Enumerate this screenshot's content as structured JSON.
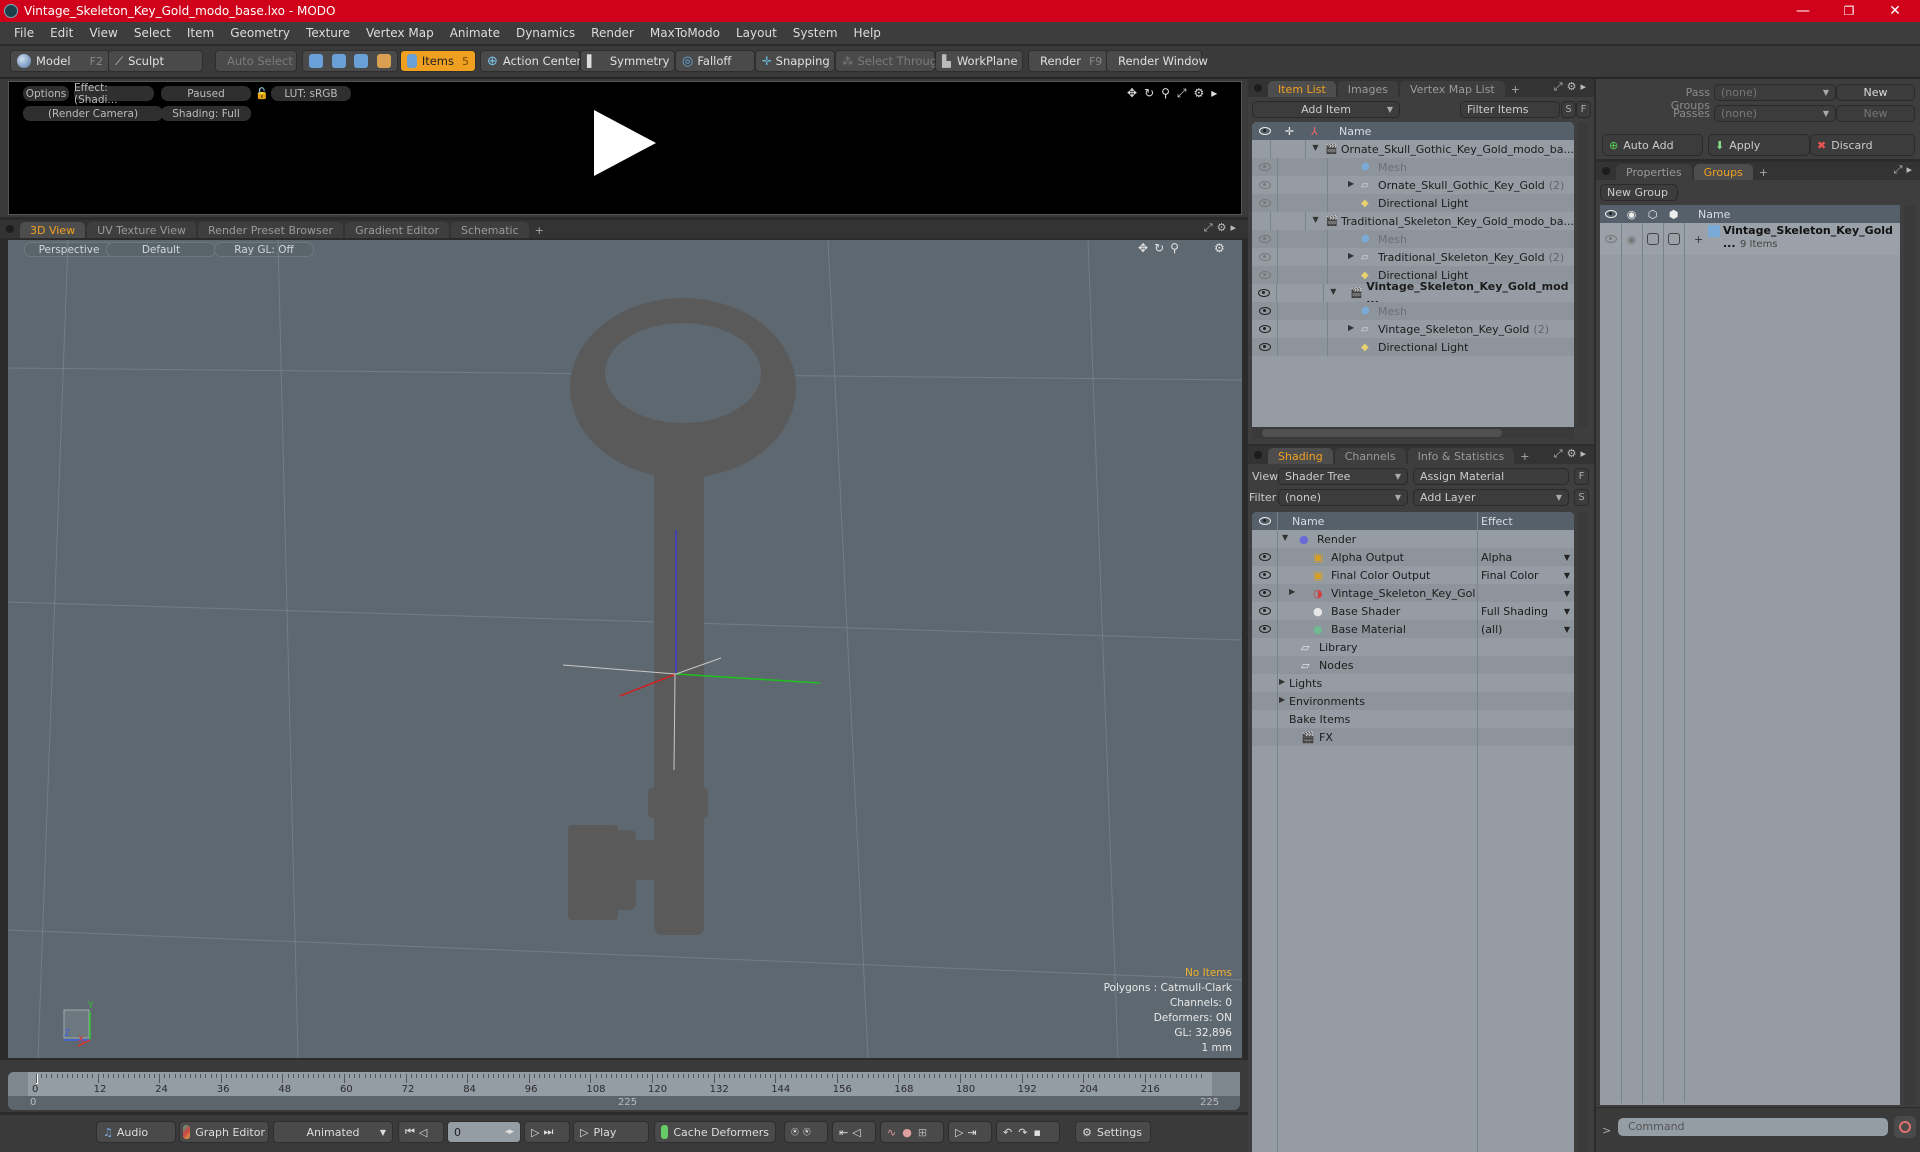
{
  "window": {
    "title": "Vintage_Skeleton_Key_Gold_modo_base.lxo - MODO",
    "minimize": "—",
    "maximize": "❐",
    "close": "✕"
  },
  "menu": [
    "File",
    "Edit",
    "View",
    "Select",
    "Item",
    "Geometry",
    "Texture",
    "Vertex Map",
    "Animate",
    "Dynamics",
    "Render",
    "MaxToModo",
    "Layout",
    "System",
    "Help"
  ],
  "toolbar": {
    "model": "Model",
    "model_key": "F2",
    "sculpt": "Sculpt",
    "auto_select": "Auto Select",
    "items": "Items",
    "items_key": "5",
    "action_center": "Action Center",
    "symmetry": "Symmetry",
    "falloff": "Falloff",
    "snapping": "Snapping",
    "select_through": "Select Through",
    "workplane": "WorkPlane",
    "render": "Render",
    "render_key": "F9",
    "render_window": "Render Window"
  },
  "render_preview": {
    "options": "Options",
    "effect": "Effect: (Shadi...",
    "status": "Paused",
    "lut": "LUT: sRGB",
    "camera": "(Render Camera)",
    "shading": "Shading: Full"
  },
  "viewport_tabs": [
    {
      "label": "3D View",
      "active": true
    },
    {
      "label": "UV Texture View"
    },
    {
      "label": "Render Preset Browser"
    },
    {
      "label": "Gradient Editor"
    },
    {
      "label": "Schematic"
    },
    {
      "label": "+"
    }
  ],
  "viewport": {
    "projection": "Perspective",
    "style": "Default",
    "raygl": "Ray GL: Off",
    "info": {
      "selection": "No Items",
      "polygons": "Polygons : Catmull-Clark",
      "channels": "Channels: 0",
      "deformers": "Deformers: ON",
      "gl": "GL: 32,896",
      "scale": "1 mm"
    },
    "axis_labels": {
      "y": "Y",
      "z": "Z",
      "x": "X"
    }
  },
  "timeline": {
    "ticks": [
      "0",
      "12",
      "24",
      "36",
      "48",
      "60",
      "72",
      "84",
      "96",
      "108",
      "120",
      "132",
      "144",
      "156",
      "168",
      "180",
      "192",
      "204",
      "216"
    ],
    "range_start": "0",
    "range_end": "225",
    "range_end_right": "225"
  },
  "transport": {
    "audio": "Audio",
    "graph_editor": "Graph Editor",
    "mode": "Animated",
    "frame": "0",
    "play": "Play",
    "cache_deformers": "Cache Deformers",
    "settings": "Settings"
  },
  "item_list": {
    "tabs": [
      {
        "label": "Item List",
        "active": true
      },
      {
        "label": "Images"
      },
      {
        "label": "Vertex Map List"
      },
      {
        "label": "+"
      }
    ],
    "add_item": "Add Item",
    "filter": "Filter Items",
    "s": "S",
    "f": "F",
    "column_name": "Name",
    "rows": [
      {
        "name": "Ornate_Skull_Gothic_Key_Gold_modo_ba...",
        "type": "scene",
        "level": 0,
        "eye": "none"
      },
      {
        "name": "Mesh",
        "type": "mesh",
        "level": 1,
        "eye": "dim",
        "dim": true
      },
      {
        "name": "Ornate_Skull_Gothic_Key_Gold",
        "count": "(2)",
        "type": "group",
        "level": 1,
        "eye": "dim",
        "expander": true
      },
      {
        "name": "Directional Light",
        "type": "light",
        "level": 1,
        "eye": "dim"
      },
      {
        "name": "Traditional_Skeleton_Key_Gold_modo_ba...",
        "type": "scene",
        "level": 0,
        "eye": "none"
      },
      {
        "name": "Mesh",
        "type": "mesh",
        "level": 1,
        "eye": "dim",
        "dim": true
      },
      {
        "name": "Traditional_Skeleton_Key_Gold",
        "count": "(2)",
        "type": "group",
        "level": 1,
        "eye": "dim",
        "expander": true
      },
      {
        "name": "Directional Light",
        "type": "light",
        "level": 1,
        "eye": "dim"
      },
      {
        "name": "Vintage_Skeleton_Key_Gold_mod ...",
        "type": "scene",
        "level": 0,
        "eye": "on",
        "bold": true
      },
      {
        "name": "Mesh",
        "type": "mesh",
        "level": 1,
        "eye": "on",
        "dim": true
      },
      {
        "name": "Vintage_Skeleton_Key_Gold",
        "count": "(2)",
        "type": "group",
        "level": 1,
        "eye": "on",
        "expander": true
      },
      {
        "name": "Directional Light",
        "type": "light",
        "level": 1,
        "eye": "on"
      }
    ]
  },
  "shading": {
    "tabs": [
      {
        "label": "Shading",
        "active": true
      },
      {
        "label": "Channels"
      },
      {
        "label": "Info & Statistics"
      },
      {
        "label": "+"
      }
    ],
    "view_label": "View",
    "view_value": "Shader Tree",
    "assign_material": "Assign Material",
    "f": "F",
    "filter_label": "Filter",
    "filter_value": "(none)",
    "add_layer": "Add Layer",
    "s": "S",
    "col_name": "Name",
    "col_effect": "Effect",
    "rows": [
      {
        "name": "Render",
        "effect": "",
        "icon": "render",
        "level": 0,
        "eye": false,
        "expanded": true
      },
      {
        "name": "Alpha Output",
        "effect": "Alpha",
        "icon": "output",
        "level": 1,
        "eye": true,
        "dropdown": true
      },
      {
        "name": "Final Color Output",
        "effect": "Final Color",
        "icon": "output",
        "level": 1,
        "eye": true,
        "dropdown": true
      },
      {
        "name": "Vintage_Skeleton_Key_Gol ...",
        "effect": "",
        "icon": "material-mask",
        "level": 1,
        "eye": true,
        "dropdown": true,
        "expander": true
      },
      {
        "name": "Base Shader",
        "effect": "Full Shading",
        "icon": "shader",
        "level": 1,
        "eye": true,
        "dropdown": true
      },
      {
        "name": "Base Material",
        "effect": "(all)",
        "icon": "material",
        "level": 1,
        "eye": true,
        "dropdown": true
      },
      {
        "name": "Library",
        "effect": "",
        "icon": "folder",
        "level": 0.5,
        "eye": false
      },
      {
        "name": "Nodes",
        "effect": "",
        "icon": "folder",
        "level": 0.5,
        "eye": false
      },
      {
        "name": "Lights",
        "effect": "",
        "icon": "none",
        "level": 0,
        "eye": false,
        "expander": true
      },
      {
        "name": "Environments",
        "effect": "",
        "icon": "none",
        "level": 0,
        "eye": false,
        "expander": true
      },
      {
        "name": "Bake Items",
        "effect": "",
        "icon": "none",
        "level": 0,
        "eye": false
      },
      {
        "name": "FX",
        "effect": "",
        "icon": "clapper",
        "level": 0.5,
        "eye": false
      }
    ]
  },
  "passes": {
    "pass_groups_label": "Pass Groups",
    "pass_groups_value": "(none)",
    "new": "New",
    "passes_label": "Passes",
    "passes_value": "(none)",
    "new_disabled": "New",
    "auto_add": "Auto Add",
    "apply": "Apply",
    "discard": "Discard"
  },
  "groups": {
    "tabs": [
      {
        "label": "Properties"
      },
      {
        "label": "Groups",
        "active": true
      },
      {
        "label": "+"
      }
    ],
    "new_group": "New Group",
    "col_name": "Name",
    "rows": [
      {
        "name": "Vintage_Skeleton_Key_Gold ...",
        "sub": "9 Items"
      }
    ]
  },
  "command": {
    "prompt": ">",
    "placeholder": "Command"
  }
}
